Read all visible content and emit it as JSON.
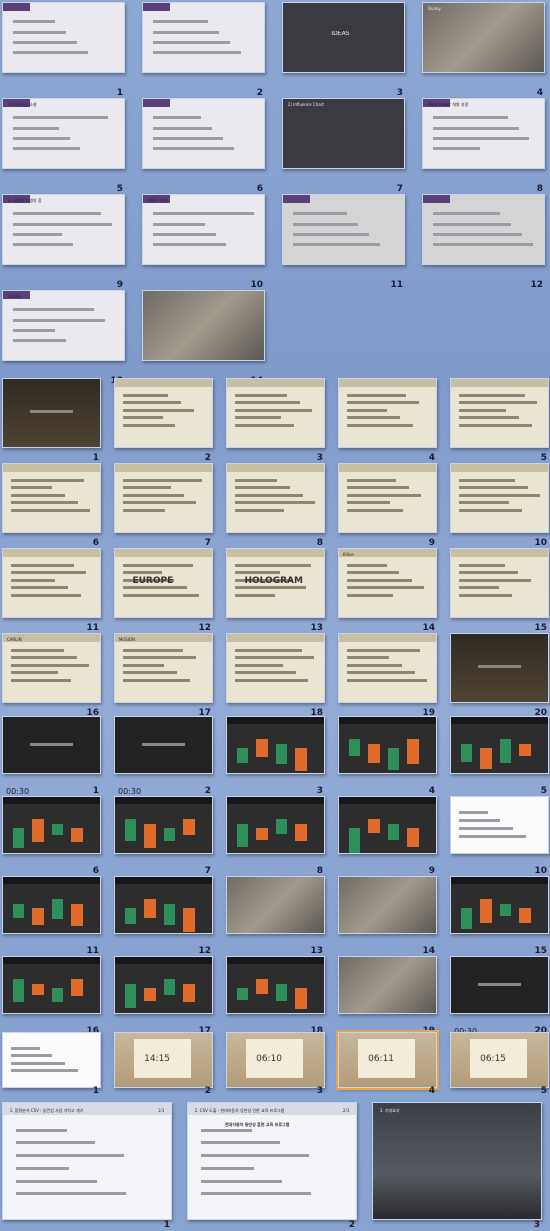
{
  "theme": {
    "accent_orange": "#e8a24a",
    "brand_purple": "#5a3f7a",
    "background_blue": "#8aa4d2"
  },
  "section1": {
    "slides": [
      {
        "num": "1",
        "theme": "t-light"
      },
      {
        "num": "2",
        "theme": "t-light"
      },
      {
        "num": "3",
        "theme": "t-dark",
        "caption": "IDEAS"
      },
      {
        "num": "4",
        "theme": "t-photo",
        "caption": "Quirky"
      },
      {
        "num": "5",
        "theme": "t-light",
        "caption": "1) 아웃소싱 소셜"
      },
      {
        "num": "6",
        "theme": "t-light"
      },
      {
        "num": "7",
        "theme": "t-dark",
        "caption": "2) Influence Chart"
      },
      {
        "num": "8",
        "theme": "t-light",
        "caption": "Pivot Power 개발 과정"
      },
      {
        "num": "9",
        "theme": "t-light",
        "caption": "3) 제품의 탄생의 힘"
      },
      {
        "num": "10",
        "theme": "t-light",
        "caption": "대한민 현재"
      },
      {
        "num": "11",
        "theme": "t-gray"
      },
      {
        "num": "12",
        "theme": "t-gray"
      },
      {
        "num": "13",
        "theme": "t-light",
        "caption": "Quirky"
      },
      {
        "num": "14",
        "theme": "t-photo"
      }
    ]
  },
  "section2": {
    "slides": [
      {
        "num": "1",
        "theme": "t-brown"
      },
      {
        "num": "2",
        "theme": "t-beige"
      },
      {
        "num": "3",
        "theme": "t-beige"
      },
      {
        "num": "4",
        "theme": "t-beige"
      },
      {
        "num": "5",
        "theme": "t-beige"
      },
      {
        "num": "6",
        "theme": "t-beige"
      },
      {
        "num": "7",
        "theme": "t-beige"
      },
      {
        "num": "8",
        "theme": "t-beige"
      },
      {
        "num": "9",
        "theme": "t-beige"
      },
      {
        "num": "10",
        "theme": "t-beige"
      },
      {
        "num": "11",
        "theme": "t-beige"
      },
      {
        "num": "12",
        "theme": "t-beige",
        "caption": "EUROPE"
      },
      {
        "num": "13",
        "theme": "t-beige",
        "caption": "HOLOGRAM"
      },
      {
        "num": "14",
        "theme": "t-beige",
        "caption": "Kllive"
      },
      {
        "num": "15",
        "theme": "t-beige"
      },
      {
        "num": "16",
        "theme": "t-beige",
        "caption": "CARLIN"
      },
      {
        "num": "17",
        "theme": "t-beige",
        "caption": "MUSION"
      },
      {
        "num": "18",
        "theme": "t-beige"
      },
      {
        "num": "19",
        "theme": "t-beige"
      },
      {
        "num": "20",
        "theme": "t-brown"
      }
    ]
  },
  "section3": {
    "slides": [
      {
        "num": "1",
        "dur": "00:30",
        "theme": "t-black"
      },
      {
        "num": "2",
        "dur": "00:30",
        "theme": "t-black"
      },
      {
        "num": "3",
        "theme": "t-charcoal"
      },
      {
        "num": "4",
        "theme": "t-charcoal"
      },
      {
        "num": "5",
        "theme": "t-charcoal"
      },
      {
        "num": "6",
        "theme": "t-charcoal"
      },
      {
        "num": "7",
        "theme": "t-charcoal"
      },
      {
        "num": "8",
        "theme": "t-charcoal"
      },
      {
        "num": "9",
        "theme": "t-charcoal"
      },
      {
        "num": "10",
        "theme": "t-white"
      },
      {
        "num": "11",
        "theme": "t-charcoal"
      },
      {
        "num": "12",
        "theme": "t-charcoal"
      },
      {
        "num": "13",
        "theme": "t-photo"
      },
      {
        "num": "14",
        "theme": "t-photo"
      },
      {
        "num": "15",
        "theme": "t-charcoal"
      },
      {
        "num": "16",
        "theme": "t-charcoal"
      },
      {
        "num": "17",
        "theme": "t-charcoal"
      },
      {
        "num": "18",
        "theme": "t-charcoal"
      },
      {
        "num": "19",
        "theme": "t-photo"
      },
      {
        "num": "20",
        "dur": "00:30",
        "theme": "t-black"
      }
    ]
  },
  "section4": {
    "slides": [
      {
        "num": "1",
        "theme": "t-white"
      },
      {
        "num": "2",
        "theme": "t-wood",
        "caption": "14:15"
      },
      {
        "num": "3",
        "theme": "t-wood",
        "caption": "06:10"
      },
      {
        "num": "4",
        "theme": "t-wood",
        "caption": "06:11",
        "selected": true
      },
      {
        "num": "5",
        "theme": "t-wood",
        "caption": "06:15"
      }
    ]
  },
  "section5": {
    "slides": [
      {
        "num": "1",
        "theme": "t-ppt",
        "caption": "1. 잠정분석 CSV : 농민업 사업 가치고 개기",
        "page": "1/3"
      },
      {
        "num": "2",
        "theme": "t-ppt",
        "caption": "2. CSV 도출 : 현대자동차 동반성 인한 교육 프로그램",
        "page": "2/3",
        "title": "현대자동차 동반성 훈련 교육 프로그램"
      },
      {
        "num": "3",
        "theme": "t-night",
        "caption": "3. 기대효과",
        "page": "3/3"
      }
    ]
  }
}
